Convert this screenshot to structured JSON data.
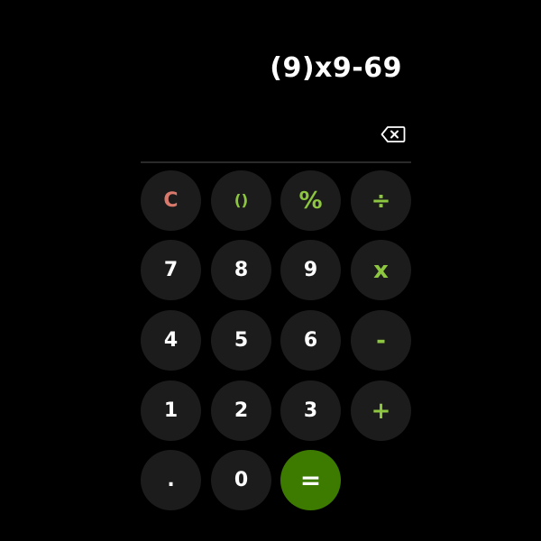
{
  "display": {
    "expression": "(9)x9-69"
  },
  "icons": {
    "backspace": "backspace-icon"
  },
  "colors": {
    "background": "#000000",
    "key_background": "#1c1c1c",
    "operator": "#8dc63f",
    "clear": "#d9796b",
    "equals_background": "#3d7a00"
  },
  "keypad": {
    "clear": "C",
    "parentheses": "()",
    "percent": "%",
    "divide": "÷",
    "seven": "7",
    "eight": "8",
    "nine": "9",
    "multiply": "x",
    "four": "4",
    "five": "5",
    "six": "6",
    "minus": "-",
    "one": "1",
    "two": "2",
    "three": "3",
    "plus": "+",
    "decimal": ".",
    "zero": "0",
    "equals": "="
  }
}
